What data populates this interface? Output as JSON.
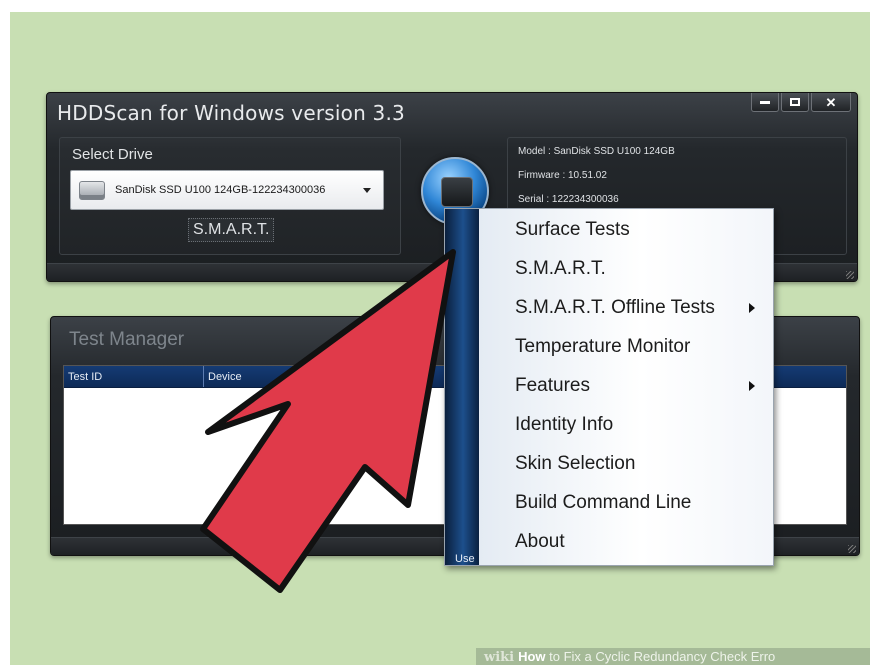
{
  "main_window": {
    "title": "HDDScan for Windows version 3.3",
    "select_drive_label": "Select Drive",
    "selected_drive": "SanDisk SSD U100 124GB-122234300036",
    "smart_button": "S.M.A.R.T.",
    "info": {
      "model": "Model : SanDisk SSD U100 124GB",
      "firmware": "Firmware : 10.51.02",
      "serial": "Serial : 122234300036"
    }
  },
  "test_manager": {
    "title": "Test Manager",
    "columns": [
      "Test ID",
      "Device"
    ]
  },
  "context_menu": {
    "stripe_label": "Use",
    "items": [
      {
        "label": "Surface Tests",
        "has_submenu": false
      },
      {
        "label": "S.M.A.R.T.",
        "has_submenu": false
      },
      {
        "label": "S.M.A.R.T. Offline Tests",
        "has_submenu": true
      },
      {
        "label": "Temperature Monitor",
        "has_submenu": false
      },
      {
        "label": "Features",
        "has_submenu": true
      },
      {
        "label": "Identity Info",
        "has_submenu": false
      },
      {
        "label": "Skin Selection",
        "has_submenu": false
      },
      {
        "label": "Build Command Line",
        "has_submenu": false
      },
      {
        "label": "About",
        "has_submenu": false
      }
    ]
  },
  "footer": {
    "brand": "wiki",
    "how": "How",
    "rest": " to Fix a Cyclic Redundancy Check Erro"
  },
  "colors": {
    "background": "#c8dfb3",
    "arrow_fill": "#e03a4a",
    "window_dark": "#1b1e21",
    "grid_header": "#153b74"
  },
  "icons": [
    "minimize-icon",
    "maximize-icon",
    "close-icon",
    "hdd-icon",
    "dropdown-caret-icon",
    "hddscan-orb-icon",
    "submenu-arrow-icon",
    "red-pointer-arrow"
  ]
}
